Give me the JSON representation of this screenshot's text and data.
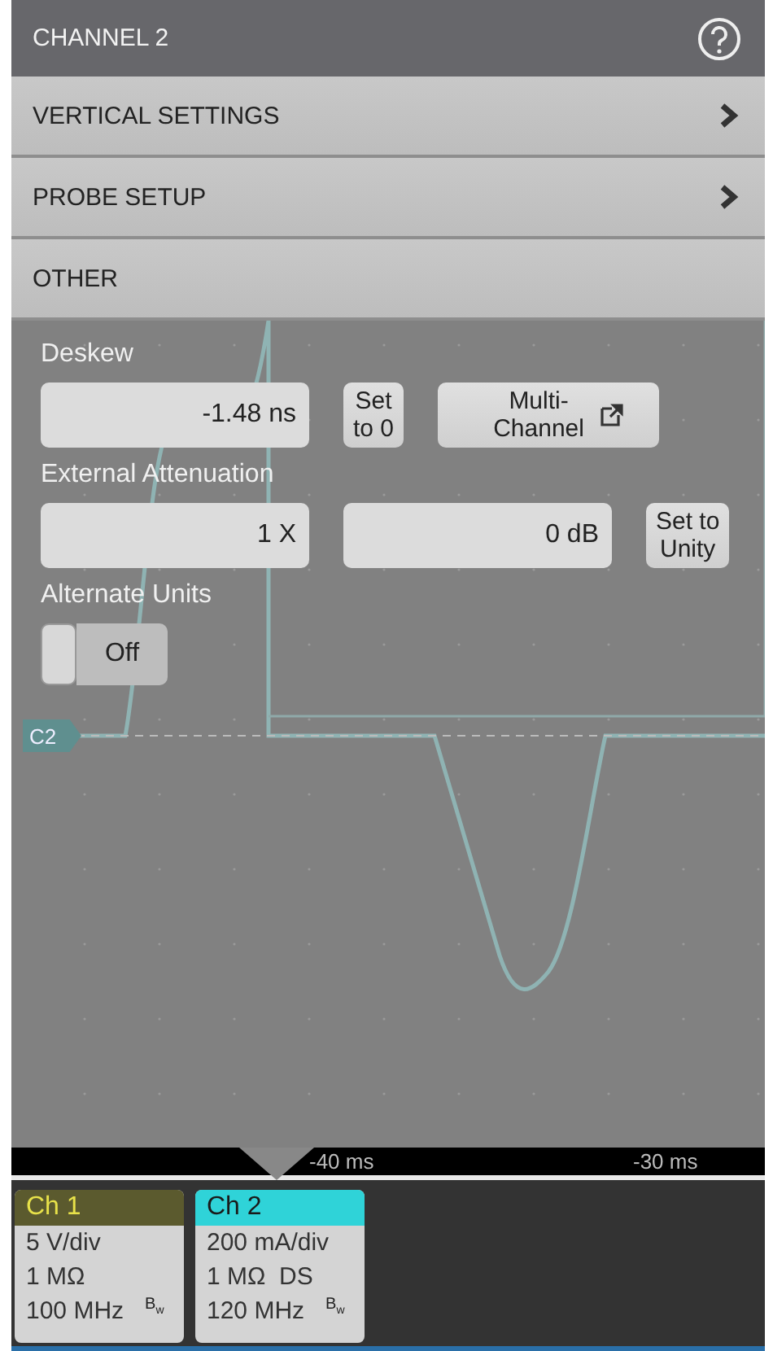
{
  "window": {
    "title": "CHANNEL 2"
  },
  "menu": [
    {
      "label": "VERTICAL SETTINGS",
      "kind": "submenu"
    },
    {
      "label": "PROBE SETUP",
      "kind": "submenu"
    },
    {
      "label": "OTHER",
      "kind": "section"
    }
  ],
  "settings": [
    {
      "label": "Deskew",
      "controls": [
        {
          "kind": "field",
          "value": "-1.48 ns"
        },
        {
          "kind": "button",
          "lines": [
            "Set",
            "to 0"
          ]
        },
        {
          "kind": "popup-button",
          "lines": [
            "Multi-",
            "Channel"
          ]
        }
      ]
    },
    {
      "label": "External Attenuation",
      "controls": [
        {
          "kind": "field",
          "value": "1 X"
        },
        {
          "kind": "field",
          "value": "0 dB"
        },
        {
          "kind": "button",
          "lines": [
            "Set to",
            "Unity"
          ]
        }
      ]
    },
    {
      "label": "Alternate Units",
      "controls": [
        {
          "kind": "toggle",
          "label": "Off",
          "on": false
        }
      ]
    }
  ],
  "waveform": {
    "marker": "C2"
  },
  "time_axis": {
    "labels": [
      "-40 ms",
      "-30 ms"
    ]
  },
  "channels": [
    {
      "name": "Ch 1",
      "color": "#5b5a2e",
      "lines": [
        "5 V/div",
        "1 MΩ",
        "100 MHz"
      ],
      "bandwidth_mark": "B$_{w}$"
    },
    {
      "name": "Ch 2",
      "color": "#2fd3d8",
      "lines": [
        "200 mA/div",
        "1 MΩ  DS",
        "120 MHz"
      ],
      "bandwidth_mark": "B$_{w}$"
    }
  ]
}
